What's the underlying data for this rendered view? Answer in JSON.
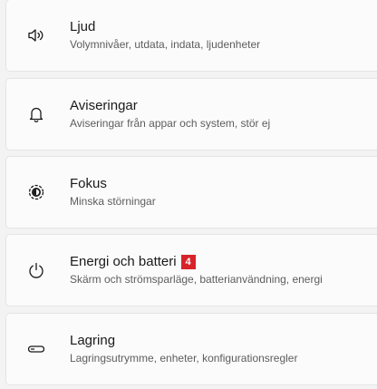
{
  "settings": {
    "items": [
      {
        "icon": "speaker-icon",
        "title": "Ljud",
        "subtitle": "Volymnivåer, utdata, indata, ljudenheter"
      },
      {
        "icon": "bell-icon",
        "title": "Aviseringar",
        "subtitle": "Aviseringar från appar och system, stör ej"
      },
      {
        "icon": "focus-icon",
        "title": "Fokus",
        "subtitle": "Minska störningar"
      },
      {
        "icon": "power-icon",
        "title": "Energi och batteri",
        "badge": "4",
        "subtitle": "Skärm och strömsparläge, batterianvändning, energi"
      },
      {
        "icon": "storage-icon",
        "title": "Lagring",
        "subtitle": "Lagringsutrymme, enheter, konfigurationsregler"
      }
    ]
  },
  "colors": {
    "badge": "#d8232a",
    "card_background": "#fbfbfb",
    "page_background": "#f3f3f3"
  }
}
